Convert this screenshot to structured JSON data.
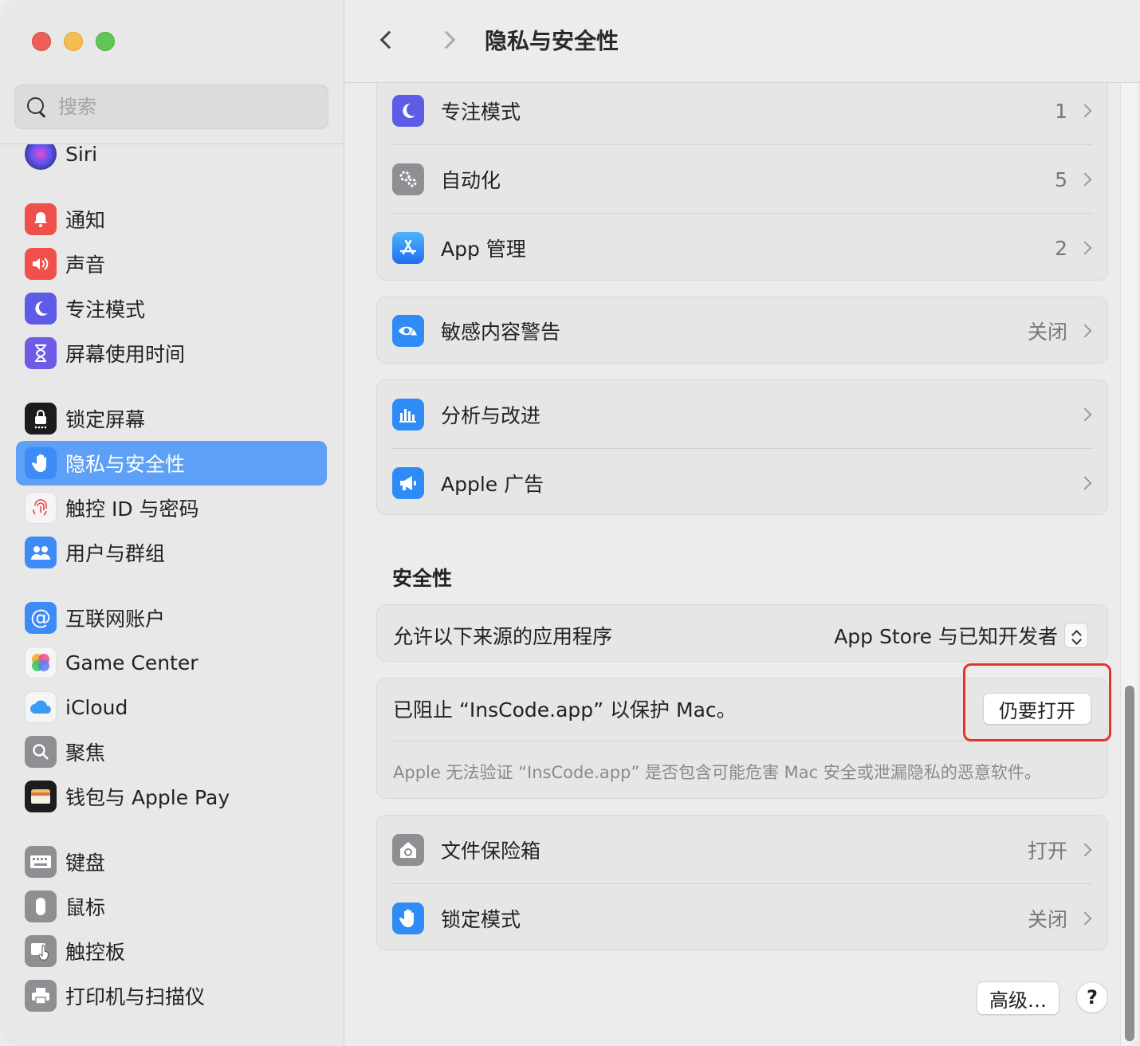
{
  "window": {
    "title": "隐私与安全性",
    "traffic_lights": [
      "close",
      "minimize",
      "maximize"
    ]
  },
  "search": {
    "placeholder": "搜索",
    "value": ""
  },
  "sidebar": {
    "items": [
      {
        "label": "Siri",
        "icon": "siri-icon",
        "color": "#6a3fd4"
      },
      {
        "label": "通知",
        "icon": "bell-icon",
        "color": "#f0504a"
      },
      {
        "label": "声音",
        "icon": "speaker-icon",
        "color": "#f0504a"
      },
      {
        "label": "专注模式",
        "icon": "moon-icon",
        "color": "#5e5ce6"
      },
      {
        "label": "屏幕使用时间",
        "icon": "hourglass-icon",
        "color": "#6e5ce6"
      },
      {
        "label": "锁定屏幕",
        "icon": "lock-icon",
        "color": "#1c1c1e"
      },
      {
        "label": "隐私与安全性",
        "icon": "hand-icon",
        "color": "#3d8bf7",
        "selected": true
      },
      {
        "label": "触控 ID 与密码",
        "icon": "fingerprint-icon",
        "color": "#f5f5f5"
      },
      {
        "label": "用户与群组",
        "icon": "users-icon",
        "color": "#3d8bf7"
      },
      {
        "label": "互联网账户",
        "icon": "at-icon",
        "color": "#3d8bf7"
      },
      {
        "label": "Game Center",
        "icon": "game-center-icon",
        "color": "#f5f5f5"
      },
      {
        "label": "iCloud",
        "icon": "cloud-icon",
        "color": "#f5f5f5"
      },
      {
        "label": "聚焦",
        "icon": "magnifier-icon",
        "color": "#8e8e93"
      },
      {
        "label": "钱包与 Apple Pay",
        "icon": "wallet-icon",
        "color": "#1c1c1e"
      },
      {
        "label": "键盘",
        "icon": "keyboard-icon",
        "color": "#8e8e93"
      },
      {
        "label": "鼠标",
        "icon": "mouse-icon",
        "color": "#8e8e93"
      },
      {
        "label": "触控板",
        "icon": "trackpad-icon",
        "color": "#8e8e93"
      },
      {
        "label": "打印机与扫描仪",
        "icon": "printer-icon",
        "color": "#8e8e93"
      }
    ]
  },
  "privacy_group": {
    "rows": [
      {
        "label": "专注模式",
        "value": "1",
        "icon": "moon-icon",
        "color": "#5e5ce6"
      },
      {
        "label": "自动化",
        "value": "5",
        "icon": "gears-icon",
        "color": "#8e8e93"
      },
      {
        "label": "App 管理",
        "value": "2",
        "icon": "app-store-icon",
        "color": "#2f8cf6"
      }
    ]
  },
  "sensitive_group": {
    "rows": [
      {
        "label": "敏感内容警告",
        "value": "关闭",
        "icon": "eye-warning-icon",
        "color": "#2f8cf6"
      }
    ]
  },
  "analytics_group": {
    "rows": [
      {
        "label": "分析与改进",
        "value": "",
        "icon": "chart-icon",
        "color": "#2f8cf6"
      },
      {
        "label": "Apple 广告",
        "value": "",
        "icon": "megaphone-icon",
        "color": "#2f8cf6"
      }
    ]
  },
  "security": {
    "title": "安全性",
    "allow_label": "允许以下来源的应用程序",
    "allow_value": "App Store 与已知开发者",
    "blocked_text": "已阻止 “InsCode.app” 以保护 Mac。",
    "open_anyway_label": "仍要打开",
    "note": "Apple 无法验证 “InsCode.app” 是否包含可能危害 Mac 安全或泄漏隐私的恶意软件。"
  },
  "vault_group": {
    "rows": [
      {
        "label": "文件保险箱",
        "value": "打开",
        "icon": "house-lock-icon",
        "color": "#8e8e93"
      },
      {
        "label": "锁定模式",
        "value": "关闭",
        "icon": "hand-icon",
        "color": "#2f8cf6"
      }
    ]
  },
  "footer": {
    "advanced_label": "高级…",
    "help_label": "?"
  },
  "highlight_color": "#e6332a",
  "accent_color": "#5da0f5"
}
